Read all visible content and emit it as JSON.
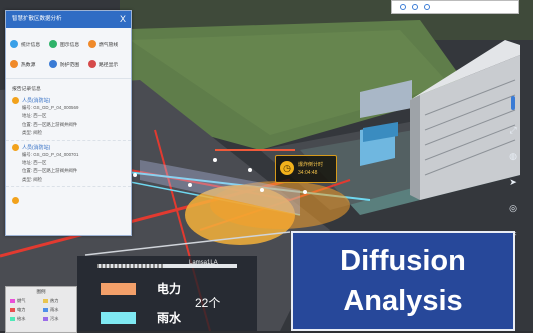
{
  "panel": {
    "title": "智慧扩散区数据分析",
    "close": "X",
    "buttons": [
      {
        "label": "统计信息",
        "color": "#3aa0e8"
      },
      {
        "label": "图示信息",
        "color": "#2fb36a"
      },
      {
        "label": "燃气管线",
        "color": "#f08a2a"
      },
      {
        "label": "热数源",
        "color": "#f08a2a"
      },
      {
        "label": "防护范围",
        "color": "#3a7bd5"
      },
      {
        "label": "路径显示",
        "color": "#d54a4a"
      }
    ],
    "section_title": "报告记录信息",
    "records": [
      {
        "name": "人员(消防站)",
        "id": "编号: GS_GD_P_04_000569",
        "area": "地址: 西一区",
        "location": "位置: 西一区路上游阀井阀件",
        "type": "类型: 阀检"
      },
      {
        "name": "人员(消防站)",
        "id": "编号: GS_GD_P_04_000701",
        "area": "地址: 西一区",
        "location": "位置: 西一区路上游阀井阀件",
        "type": "类型: 阀检"
      }
    ]
  },
  "popup": {
    "title": "爆炸倒计时",
    "time": "34:04:48"
  },
  "legend": {
    "tag": "Lamsa1LA",
    "electric": "电力",
    "rain": "雨水",
    "count": "22个",
    "colors": {
      "electric": "#f3a06a",
      "rain": "#7fe9f3"
    }
  },
  "mini_legend": {
    "title": "图例",
    "items": [
      {
        "label": "燃气",
        "color": "#e94fd8"
      },
      {
        "label": "热力",
        "color": "#e9c44f"
      },
      {
        "label": "电力",
        "color": "#e94f4f"
      },
      {
        "label": "雨水",
        "color": "#4f8fe9"
      },
      {
        "label": "给水",
        "color": "#4fe9b7"
      },
      {
        "label": "污水",
        "color": "#9b6ce9"
      }
    ]
  },
  "overlay": {
    "line1": "Diffusion",
    "line2": "Analysis"
  }
}
